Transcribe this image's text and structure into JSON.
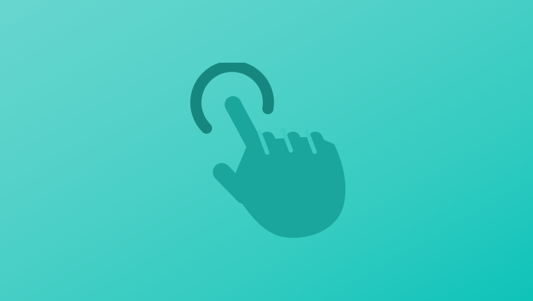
{
  "background": {
    "gradient_start": "#68d6cf",
    "gradient_end": "#0ec3b8"
  },
  "icon": {
    "name": "tap-gesture-icon",
    "ripple_color": "#16877f",
    "hand_color": "#1aa69d"
  }
}
